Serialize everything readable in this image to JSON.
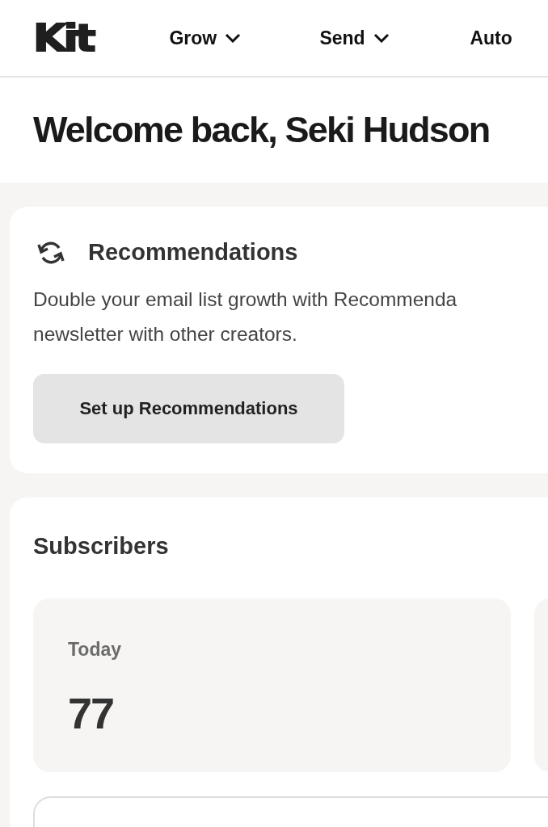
{
  "header": {
    "logo": "Kit",
    "nav": [
      {
        "label": "Grow",
        "dropdown": true
      },
      {
        "label": "Send",
        "dropdown": true
      },
      {
        "label": "Auto",
        "dropdown": false
      }
    ]
  },
  "title": "Welcome back, Seki Hudson",
  "recommendations": {
    "heading": "Recommendations",
    "description_lines": [
      "Double your email list growth with Recommenda",
      "newsletter with other creators."
    ],
    "button": "Set up Recommendations"
  },
  "subscribers": {
    "heading": "Subscribers",
    "stats": [
      {
        "label": "Today",
        "value": "77"
      }
    ]
  }
}
